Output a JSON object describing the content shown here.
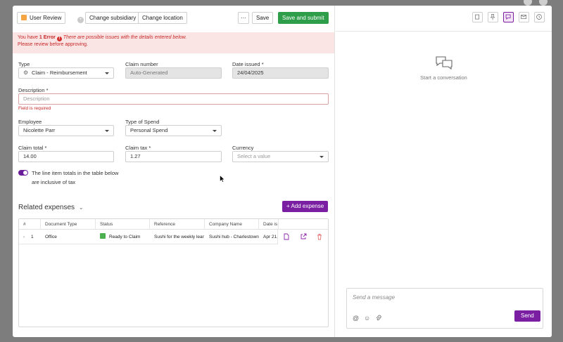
{
  "toolbar": {
    "user_review_label": "User Review",
    "change_subsidiary_label": "Change subsidiary",
    "change_location_label": "Change location",
    "more_label": "···",
    "save_label": "Save",
    "save_submit_label": "Save and submit"
  },
  "error": {
    "prefix": "You have",
    "count_label": "1 Error",
    "message": "There are possible issues with the details entered below.",
    "line2": "Please review before approving."
  },
  "form": {
    "type_label": "Type",
    "type_value": "Claim - Reimbursement",
    "claim_number_label": "Claim number",
    "claim_number_value": "Auto-Generated",
    "date_issued_label": "Date issued *",
    "date_issued_value": "24/04/2025",
    "description_label": "Description *",
    "description_placeholder": "Description",
    "description_error": "Field is required",
    "employee_label": "Employee",
    "employee_value": "Nicolette Parr",
    "type_of_spend_label": "Type of Spend",
    "type_of_spend_value": "Personal Spend",
    "claim_total_label": "Claim total *",
    "claim_total_value": "14.00",
    "claim_tax_label": "Claim tax *",
    "claim_tax_value": "1.27",
    "currency_label": "Currency",
    "currency_placeholder": "Select a value",
    "tax_toggle_line1": "The line item totals in the table below",
    "tax_toggle_line2": "are inclusive of tax"
  },
  "related": {
    "title": "Related expenses",
    "add_label": "+ Add expense",
    "columns": [
      "#",
      "Document Type",
      "Status",
      "Reference",
      "Company Name",
      "Date is"
    ],
    "rows": [
      {
        "expand": "›",
        "index": "1",
        "document_type": "Office",
        "status": "Ready to Claim",
        "reference": "Sushi for the weekly lear",
        "company": "Sushi hub - Charlestown",
        "date": "Apr 21,"
      }
    ]
  },
  "conversation": {
    "empty_text": "Start a conversation",
    "message_placeholder": "Send a message",
    "send_label": "Send"
  },
  "colors": {
    "brand_purple": "#7a1fa2",
    "green": "#2e9e4a",
    "error_red": "#c62828"
  }
}
